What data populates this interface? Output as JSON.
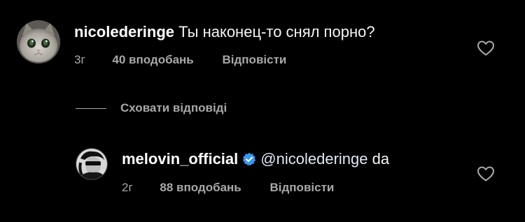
{
  "comments": [
    {
      "username": "nicolederinge",
      "text": "Ты наконец-то снял порно?",
      "time": "3г",
      "likes": "40 вподобань",
      "reply_label": "Відповісти",
      "avatar_icon": "cat-avatar-icon",
      "like_icon": "heart-outline-icon"
    }
  ],
  "hide_replies_label": "Сховати відповіді",
  "replies": [
    {
      "username": "melovin_official",
      "verified": true,
      "mention": "@nicolederinge",
      "text": " da",
      "time": "2г",
      "likes": "88 вподобань",
      "reply_label": "Відповісти",
      "avatar_icon": "person-avatar-icon",
      "like_icon": "heart-outline-icon"
    }
  ],
  "colors": {
    "background": "#000000",
    "primary_text": "#ffffff",
    "secondary_text": "#a8a8a8",
    "verified_badge": "#3897f0"
  }
}
